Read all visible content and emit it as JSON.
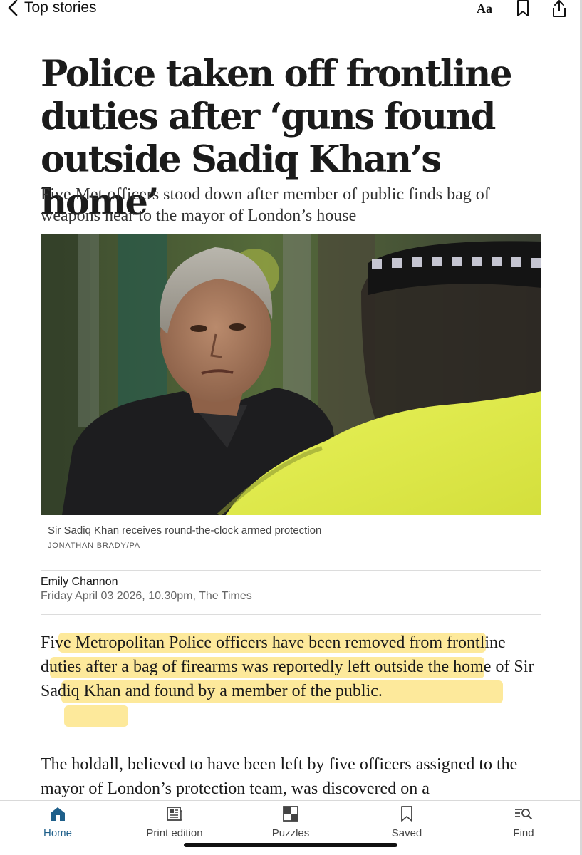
{
  "topbar": {
    "back_label": "Top stories",
    "font_button": "Aa"
  },
  "article": {
    "headline": "Police taken off frontline duties after ‘guns found outside Sadiq Khan’s home’",
    "standfirst": "Five Met officers stood down after member of public finds bag of weapons near to the mayor of London’s house",
    "image_caption": "Sir Sadiq Khan receives round-the-clock armed protection",
    "image_credit": "JONATHAN BRADY/PA",
    "author": "Emily Channon",
    "dateline": "Friday April 03 2026, 10.30pm, The Times",
    "paragraphs": [
      "Five Metropolitan Police officers have been removed from frontline duties after a bag of firearms was reportedly left outside the home of Sir Sadiq Khan and found by a member of the public.",
      "The holdall, believed to have been left by five officers assigned to the mayor of London’s protection team, was discovered on a"
    ]
  },
  "bottom_nav": {
    "items": [
      {
        "label": "Home",
        "icon": "home-icon",
        "active": true
      },
      {
        "label": "Print edition",
        "icon": "newspaper-icon",
        "active": false
      },
      {
        "label": "Puzzles",
        "icon": "puzzle-grid-icon",
        "active": false
      },
      {
        "label": "Saved",
        "icon": "bookmark-icon",
        "active": false
      },
      {
        "label": "Find",
        "icon": "search-list-icon",
        "active": false
      }
    ]
  },
  "colors": {
    "highlight": "#fde58a",
    "active_nav": "#1e5f8a",
    "hi_vis_yellow": "#e6f04a"
  }
}
